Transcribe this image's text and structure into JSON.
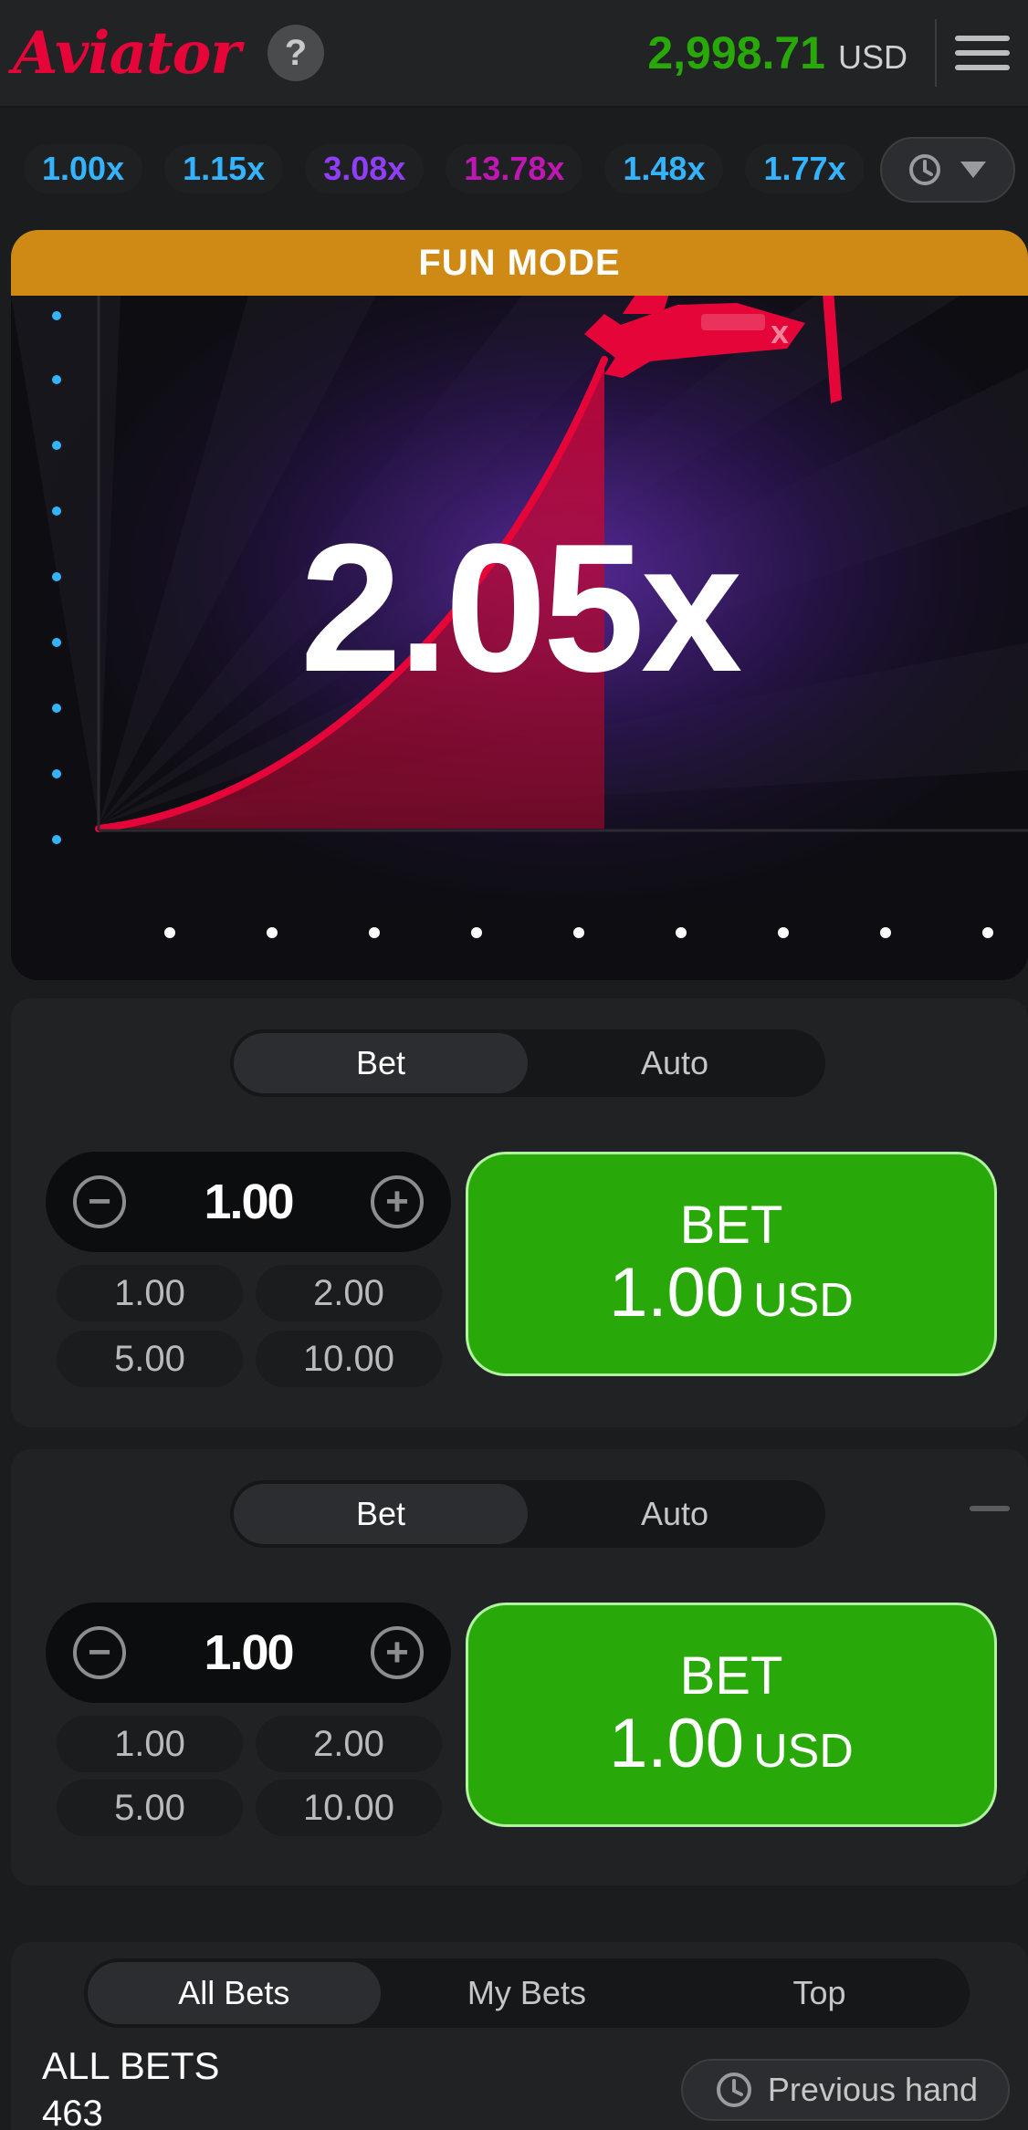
{
  "header": {
    "logo": "Aviator",
    "help_label": "?",
    "balance": "2,998.71",
    "currency": "USD"
  },
  "history": {
    "multipliers": [
      {
        "value": "1.00x",
        "color": "#34b4ff"
      },
      {
        "value": "1.15x",
        "color": "#34b4ff"
      },
      {
        "value": "3.08x",
        "color": "#913ef8"
      },
      {
        "value": "13.78x",
        "color": "#c017b4"
      },
      {
        "value": "1.48x",
        "color": "#34b4ff"
      },
      {
        "value": "1.77x",
        "color": "#34b4ff"
      }
    ]
  },
  "game": {
    "banner": "FUN MODE",
    "multiplier": "2.05x",
    "curve_color": "#e50539",
    "banner_color": "#cf8a15"
  },
  "bet_panels": [
    {
      "tabs": [
        "Bet",
        "Auto"
      ],
      "stake": "1.00",
      "quick_amounts": [
        "1.00",
        "2.00",
        "5.00",
        "10.00"
      ],
      "bet_label": "BET",
      "bet_amount": "1.00",
      "bet_currency": "USD"
    },
    {
      "tabs": [
        "Bet",
        "Auto"
      ],
      "stake": "1.00",
      "quick_amounts": [
        "1.00",
        "2.00",
        "5.00",
        "10.00"
      ],
      "bet_label": "BET",
      "bet_amount": "1.00",
      "bet_currency": "USD"
    }
  ],
  "bets": {
    "tabs": [
      "All Bets",
      "My Bets",
      "Top"
    ],
    "title": "ALL BETS",
    "count": "463",
    "previous_hand": "Previous hand"
  },
  "colors": {
    "accent_green": "#28a909",
    "brand_red": "#e50539",
    "background": "#1b1c1d"
  }
}
